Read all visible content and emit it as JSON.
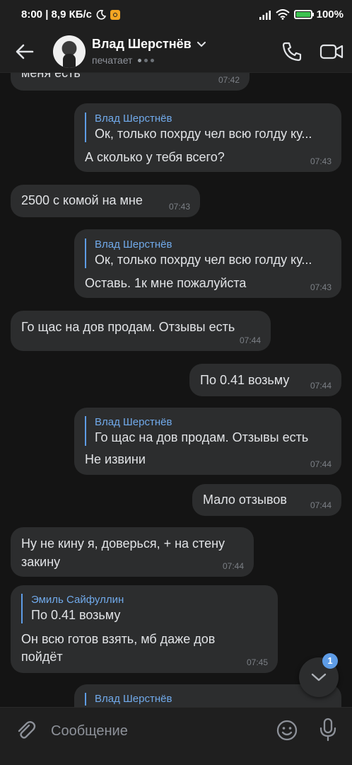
{
  "status_bar": {
    "time_speed": "8:00 | 8,9 КБ/с",
    "battery": "100%"
  },
  "header": {
    "name": "Влад Шерстнёв",
    "status": "печатает"
  },
  "messages": [
    {
      "text": "меня есть",
      "time": "07:42"
    },
    {
      "reply_name": "Влад Шерстнёв",
      "reply_text": "Ок, только похрду чел всю голду ку...",
      "text": "А сколько у тебя всего?",
      "time": "07:43"
    },
    {
      "text": "2500 с комой на мне",
      "time": "07:43"
    },
    {
      "reply_name": "Влад Шерстнёв",
      "reply_text": "Ок, только похрду чел всю голду ку...",
      "text": "Оставь. 1к мне пожалуйста",
      "time": "07:43"
    },
    {
      "text": "Го щас на дов продам. Отзывы есть",
      "time": "07:44"
    },
    {
      "text": "По 0.41 возьму",
      "time": "07:44"
    },
    {
      "reply_name": "Влад Шерстнёв",
      "reply_text": "Го щас на дов продам. Отзывы есть",
      "text": "Не извини",
      "time": "07:44"
    },
    {
      "text": "Мало отзывов",
      "time": "07:44"
    },
    {
      "text_line1": "Ну не кину я, доверься, + на стену",
      "text_line2": "закину",
      "time": "07:44"
    },
    {
      "reply_name": "Эмиль Сайфуллин",
      "reply_text": "По 0.41 возьму",
      "text_line1": "Он всю готов взять, мб даже дов",
      "text_line2": "пойдёт",
      "time": "07:45"
    },
    {
      "reply_name": "Влад Шерстнёв"
    }
  ],
  "scroll_badge": "1",
  "composer": {
    "placeholder": "Сообщение"
  },
  "colors": {
    "background": "#141414",
    "bubble": "#2c2d2e",
    "accent": "#5e9ce6"
  }
}
